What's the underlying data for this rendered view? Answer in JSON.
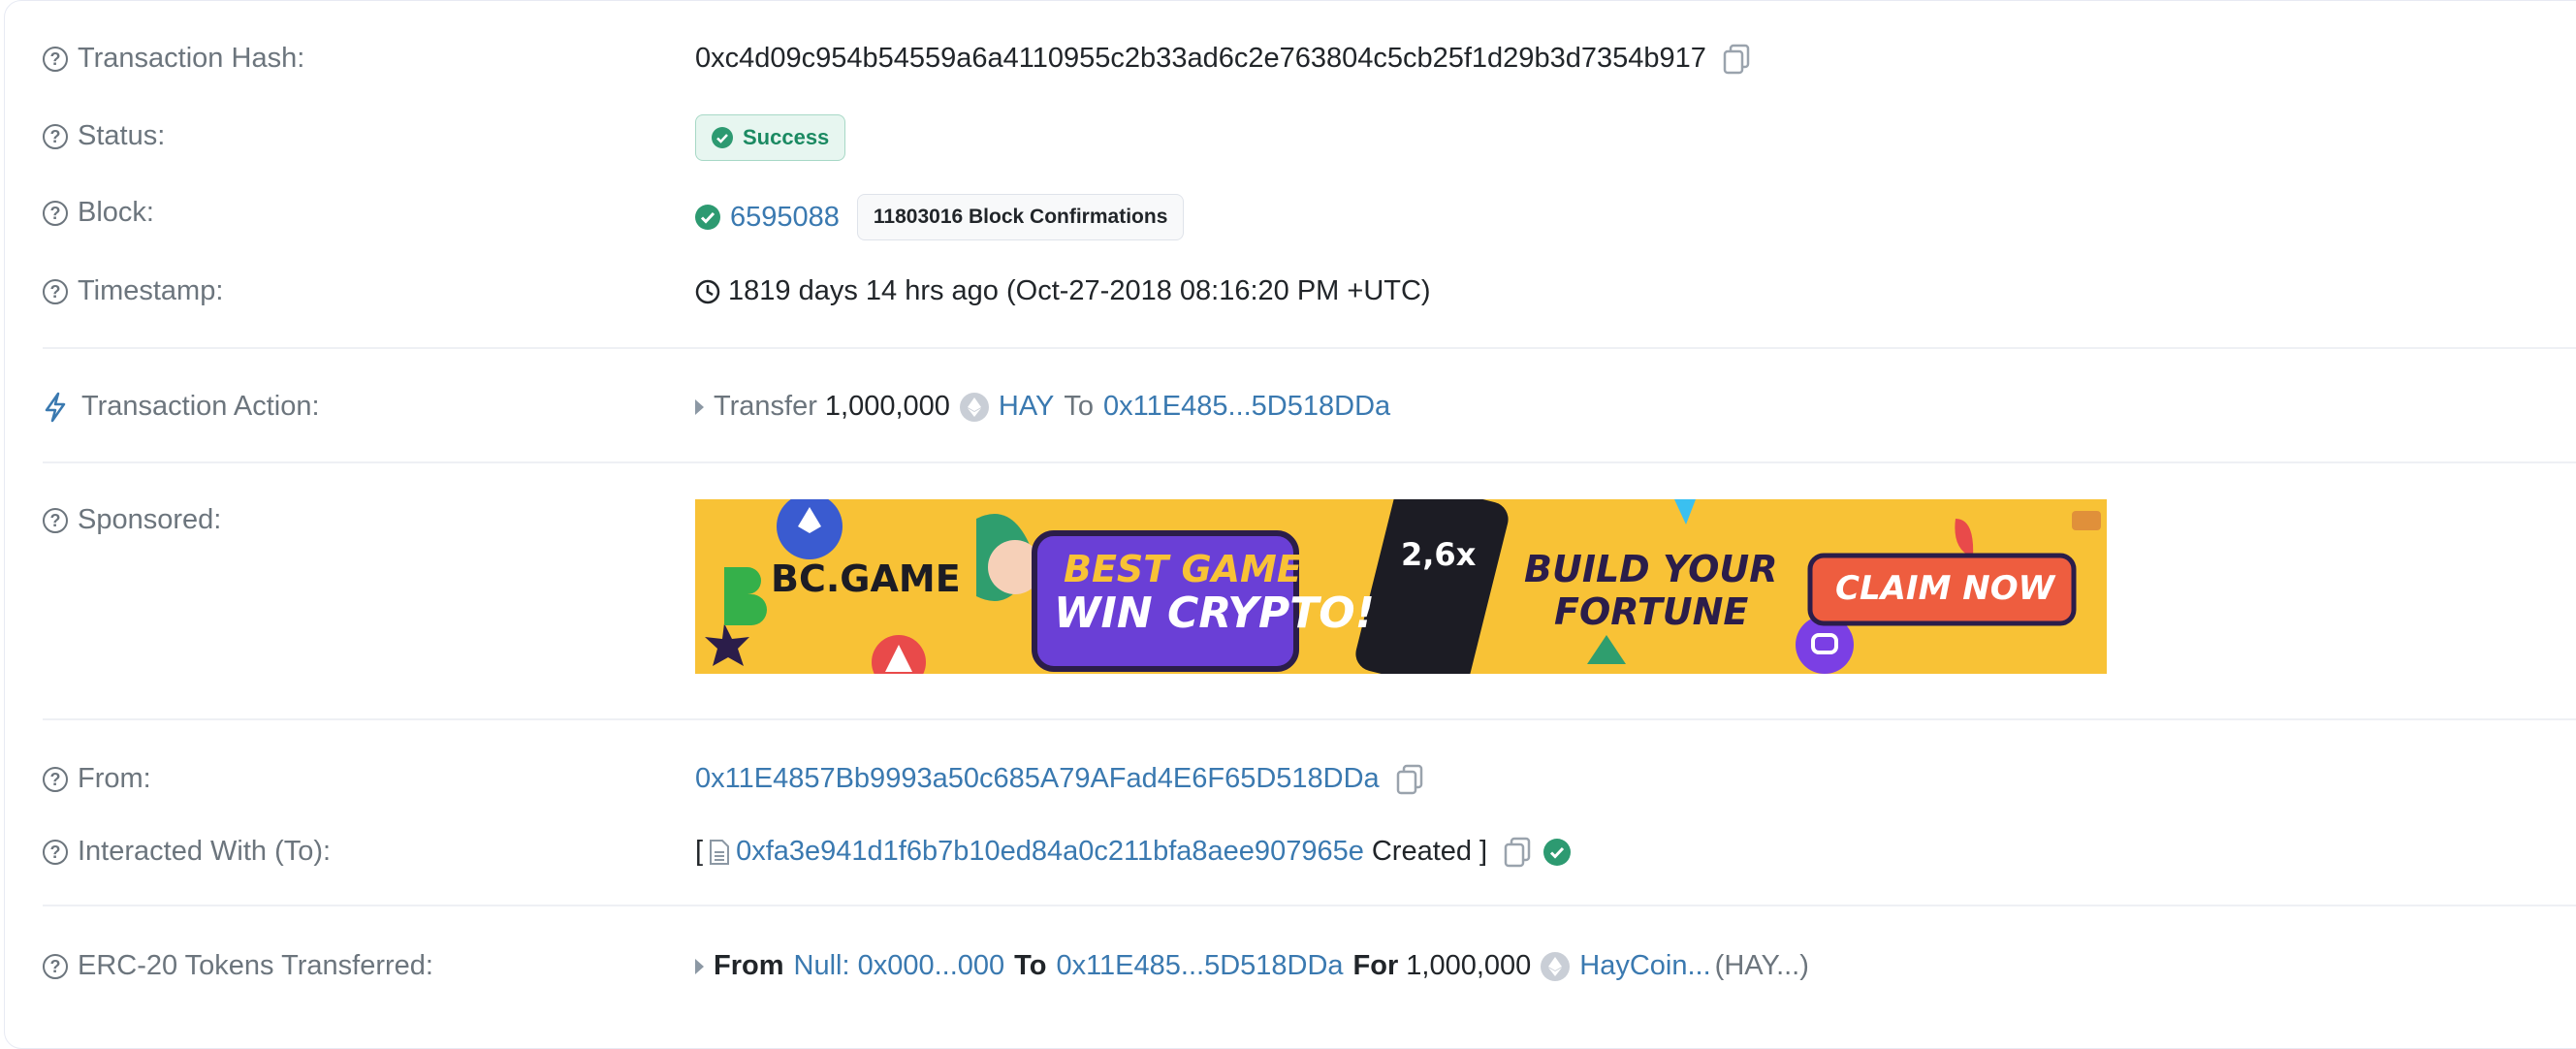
{
  "rows": {
    "hash": {
      "label": "Transaction Hash:",
      "value": "0xc4d09c954b54559a6a4110955c2b33ad6c2e763804c5cb25f1d29b3d7354b917"
    },
    "status": {
      "label": "Status:",
      "value": "Success"
    },
    "block": {
      "label": "Block:",
      "number": "6595088",
      "confirmations": "11803016 Block Confirmations"
    },
    "timestamp": {
      "label": "Timestamp:",
      "value": "1819 days 14 hrs ago (Oct-27-2018 08:16:20 PM +UTC)"
    },
    "action": {
      "label": "Transaction Action:",
      "verb": "Transfer",
      "amount": "1,000,000",
      "token": "HAY",
      "to_word": "To",
      "to_address": "0x11E485...5D518DDa"
    },
    "sponsored": {
      "label": "Sponsored:"
    },
    "from": {
      "label": "From:",
      "value": "0x11E4857Bb9993a50c685A79AFad4E6F65D518DDa"
    },
    "to": {
      "label": "Interacted With (To):",
      "open_bracket": "[",
      "address": "0xfa3e941d1f6b7b10ed84a0c211bfa8aee907965e",
      "created": "Created",
      "close_bracket": "]"
    },
    "erc20": {
      "label": "ERC-20 Tokens Transferred:",
      "from_word": "From",
      "from_address": "Null: 0x000...000",
      "to_word": "To",
      "to_address": "0x11E485...5D518DDa",
      "for_word": "For",
      "amount": "1,000,000",
      "token_name": "HayCoin...",
      "token_symbol": "(HAY...)"
    }
  },
  "ad": {
    "brand": "BC.GAME",
    "headline_1": "BEST GAME TO",
    "headline_2": "WIN CRYPTO!",
    "multiplier": "2,6x",
    "tagline_1": "BUILD YOUR",
    "tagline_2": "FORTUNE",
    "cta": "CLAIM NOW"
  },
  "colors": {
    "link": "#3a79b0",
    "success": "#1b8a62",
    "ad_background": "#f8c236",
    "ad_cta": "#ee5d3f"
  },
  "icons": [
    "question-icon",
    "copy-icon",
    "check-circle-icon",
    "clock-icon",
    "lightning-icon",
    "caret-right-icon",
    "token-icon",
    "file-icon"
  ]
}
